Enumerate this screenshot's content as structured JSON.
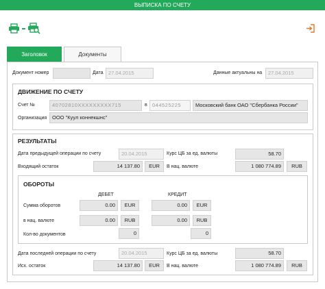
{
  "window": {
    "title": "ВЫПИСКА ПО СЧЕТУ"
  },
  "tabs": [
    {
      "label": "Заголовок"
    },
    {
      "label": "Документы"
    }
  ],
  "header": {
    "doc_number_label": "Документ номер",
    "doc_number_value": "",
    "date_label": "Дата",
    "date_value": "27.04.2015",
    "actual_label": "Данные актуальны на",
    "actual_value": "27.04.2015"
  },
  "movement": {
    "title": "ДВИЖЕНИЕ ПО СЧЕТУ",
    "account_label": "Счет №",
    "account_value": "40702810XXXXXXXXX715",
    "in_label": "в",
    "bic_value": "044525225",
    "bank_value": "Московский банк ОАО \"Сбербанка России\"",
    "org_label": "Организация",
    "org_value": "ООО \"Куул коннекшнс\""
  },
  "results": {
    "title": "РЕЗУЛЬТАТЫ",
    "prev_date_label": "Дата предыдущей операции по счету",
    "prev_date_value": "20.04.2015",
    "rate_label_1": "Курс ЦБ за ед. валюты",
    "rate_value_1": "58.70",
    "in_balance_label": "Входящий остаток",
    "in_balance_value": "14 137.80",
    "in_balance_currency": "EUR",
    "nat_label_1": "В нац. валюте",
    "nat_value_1": "1 080 774.89",
    "nat_currency_1": "RUB",
    "turnover": {
      "title": "ОБОРОТЫ",
      "debit_label": "ДЕБЕТ",
      "credit_label": "КРЕДИТ",
      "sum_label": "Сумма оборотов",
      "debit_sum": "0.00",
      "debit_sum_cur": "EUR",
      "credit_sum": "0.00",
      "credit_sum_cur": "EUR",
      "nat_label": "в нац. валюте",
      "debit_nat": "0.00",
      "debit_nat_cur": "RUB",
      "credit_nat": "0.00",
      "credit_nat_cur": "RUB",
      "count_label": "Кол-во документов",
      "debit_count": "0",
      "credit_count": "0"
    },
    "last_date_label": "Дата последней операции по счету",
    "last_date_value": "20.04.2015",
    "rate_label_2": "Курс ЦБ за ед. валюты",
    "rate_value_2": "58.70",
    "out_balance_label": "Исх. остаток",
    "out_balance_value": "14 137.80",
    "out_balance_currency": "EUR",
    "nat_label_2": "В нац. валюте",
    "nat_value_2": "1 080 774.89",
    "nat_currency_2": "RUB"
  },
  "colors": {
    "accent": "#23a95a",
    "field": "#e6e6e6",
    "border": "#c8c8c8"
  },
  "icons": [
    "print-icon",
    "print-preview-icon",
    "exit-icon"
  ]
}
